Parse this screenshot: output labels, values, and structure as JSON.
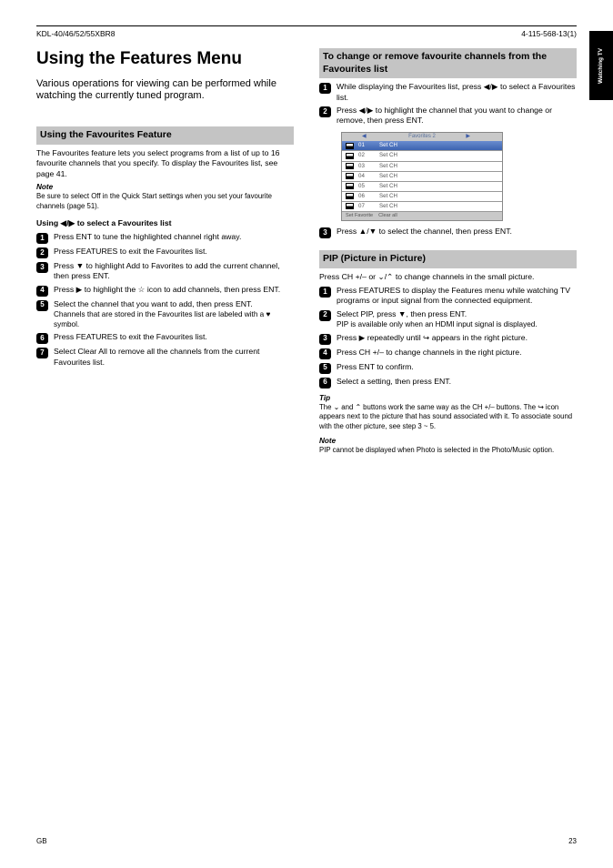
{
  "header_left": "KDL-40/46/52/55XBR8",
  "header_right": "4-115-568-13(1)",
  "tab_label": "Watching TV",
  "title": "Using the Features Menu",
  "subtitle": "Various operations for viewing can be performed while watching the currently tuned program.",
  "sections": {
    "favourites": {
      "heading": "Using the Favourites Feature",
      "intro": "The Favourites feature lets you select programs from a list of up to 16 favourite channels that you specify. To display the Favourites list, see page 41.",
      "note_label": "Note",
      "note_body": "Be sure to select Off in the Quick Start settings when you set your favourite channels (page 51).",
      "sub1": "Using ◀/▶ to select a Favourites list",
      "steps1": [
        {
          "n": "1",
          "text": "Press ENT to tune the highlighted channel right away."
        },
        {
          "n": "2",
          "text": "Press FEATURES to exit the Favourites list."
        },
        {
          "n": "3",
          "text": "Press ▼ to highlight Add to Favorites to add the current channel, then press ENT."
        },
        {
          "n": "4",
          "text": "Press ▶ to highlight the ☆ icon to add channels, then press ENT."
        },
        {
          "n": "5",
          "text": "Select the channel that you want to add, then press ENT.",
          "sub": "Channels that are stored in the Favourites list are labeled with a ♥ symbol."
        },
        {
          "n": "6",
          "text": "Press FEATURES to exit the Favourites list."
        },
        {
          "n": "7",
          "text": "Select Clear All to remove all the channels from the current Favourites list."
        }
      ],
      "sub2": "To change or remove favourite channels from the Favourites list",
      "steps2": [
        {
          "n": "1",
          "text": "While displaying the Favourites list, press ◀/▶ to select a Favourites list."
        },
        {
          "n": "2",
          "text": "Press ◀/▶ to highlight the channel that you want to change or remove, then press ENT."
        },
        {
          "n": "3",
          "text": "Press ▲/▼ to select the channel, then press ENT."
        }
      ],
      "screen": {
        "header": "Favorites 2",
        "rows": [
          {
            "num": "01",
            "name": "Set CH"
          },
          {
            "num": "02",
            "name": "Set CH"
          },
          {
            "num": "03",
            "name": "Set CH"
          },
          {
            "num": "04",
            "name": "Set CH"
          },
          {
            "num": "05",
            "name": "Set CH"
          },
          {
            "num": "06",
            "name": "Set CH"
          },
          {
            "num": "07",
            "name": "Set CH"
          }
        ],
        "footer_left": "Set Favorite",
        "footer_right": "Clear all"
      }
    },
    "pip": {
      "heading": "PIP (Picture in Picture)",
      "intro": "Press CH +/– or ⌄/⌃ to change channels in the small picture.",
      "steps": [
        {
          "n": "1",
          "text": "Press FEATURES to display the Features menu while watching TV programs or input signal from the connected equipment."
        },
        {
          "n": "2",
          "text": "Select PIP, press ▼, then press ENT.",
          "sub": "PIP is available only when an HDMI input signal is displayed."
        },
        {
          "n": "3",
          "text": "Press ▶ repeatedly until ↪ appears in the right picture."
        },
        {
          "n": "4",
          "text": "Press CH +/– to change channels in the right picture."
        },
        {
          "n": "5",
          "text": "Press ENT to confirm."
        },
        {
          "n": "6",
          "text": "Select a setting, then press ENT."
        }
      ],
      "tip_label": "Tip",
      "tip": "The ⌄ and ⌃ buttons work the same way as the CH +/– buttons. The ↪ icon appears next to the picture that has sound associated with it. To associate sound with the other picture, see step 3 ~ 5.",
      "note_label": "Note",
      "note_body": "PIP cannot be displayed when Photo is selected in the Photo/Music option."
    }
  },
  "footer_left": "GB",
  "footer_right": "23"
}
